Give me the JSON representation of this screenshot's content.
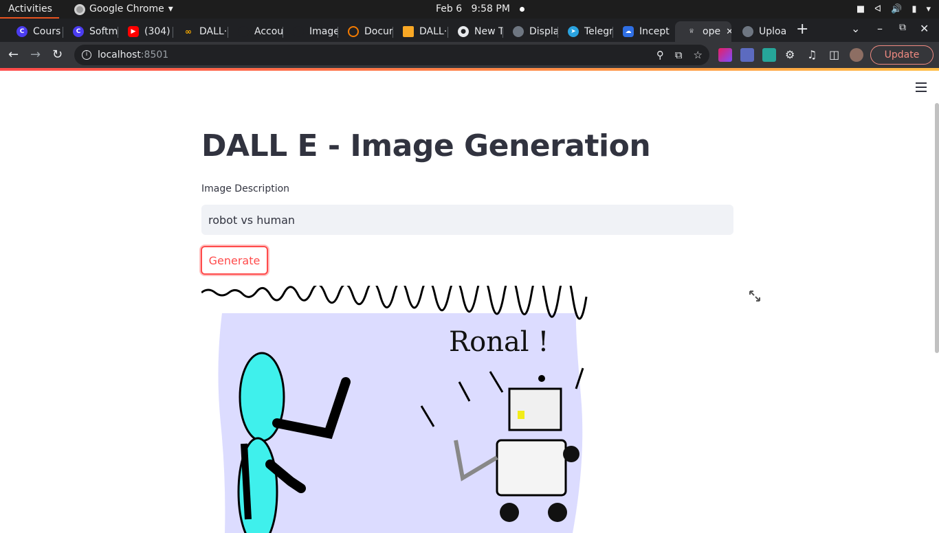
{
  "os_bar": {
    "activities": "Activities",
    "app_name": "Google Chrome",
    "date": "Feb 6",
    "time": "9:58 PM"
  },
  "tabs": [
    {
      "label": "Cours",
      "icon_color": "#4b3cf0"
    },
    {
      "label": "Softm",
      "icon_color": "#4b3cf0"
    },
    {
      "label": "(304) I",
      "icon_color": "#ff0000"
    },
    {
      "label": "DALL·",
      "icon_color": "#f9ab00"
    },
    {
      "label": "Accou",
      "icon_color": "#202124"
    },
    {
      "label": "Image",
      "icon_color": "#202124"
    },
    {
      "label": "Docur",
      "icon_color": "#f57c00"
    },
    {
      "label": "DALL·",
      "icon_color": "#f9a825"
    },
    {
      "label": "New T",
      "icon_color": "#e8eaed"
    },
    {
      "label": "Displa",
      "icon_color": "#6e7681"
    },
    {
      "label": "Telegr",
      "icon_color": "#2aa3e0"
    },
    {
      "label": "Incept",
      "icon_color": "#2f6fe4"
    },
    {
      "label": "ope",
      "icon_color": "#e8eaed"
    },
    {
      "label": "Uploa",
      "icon_color": "#6e7681"
    }
  ],
  "address_bar": {
    "host": "localhost",
    "port": ":8501"
  },
  "toolbar": {
    "update_label": "Update"
  },
  "app": {
    "title": "DALL E - Image Generation",
    "input_label": "Image Description",
    "input_value": "robot vs human",
    "button_label": "Generate",
    "image_text": "Ronal !"
  },
  "colors": {
    "accent": "#ff4b4b",
    "text": "#31333f",
    "input_bg": "#f0f2f6",
    "image_bg": "#dcdcff"
  }
}
